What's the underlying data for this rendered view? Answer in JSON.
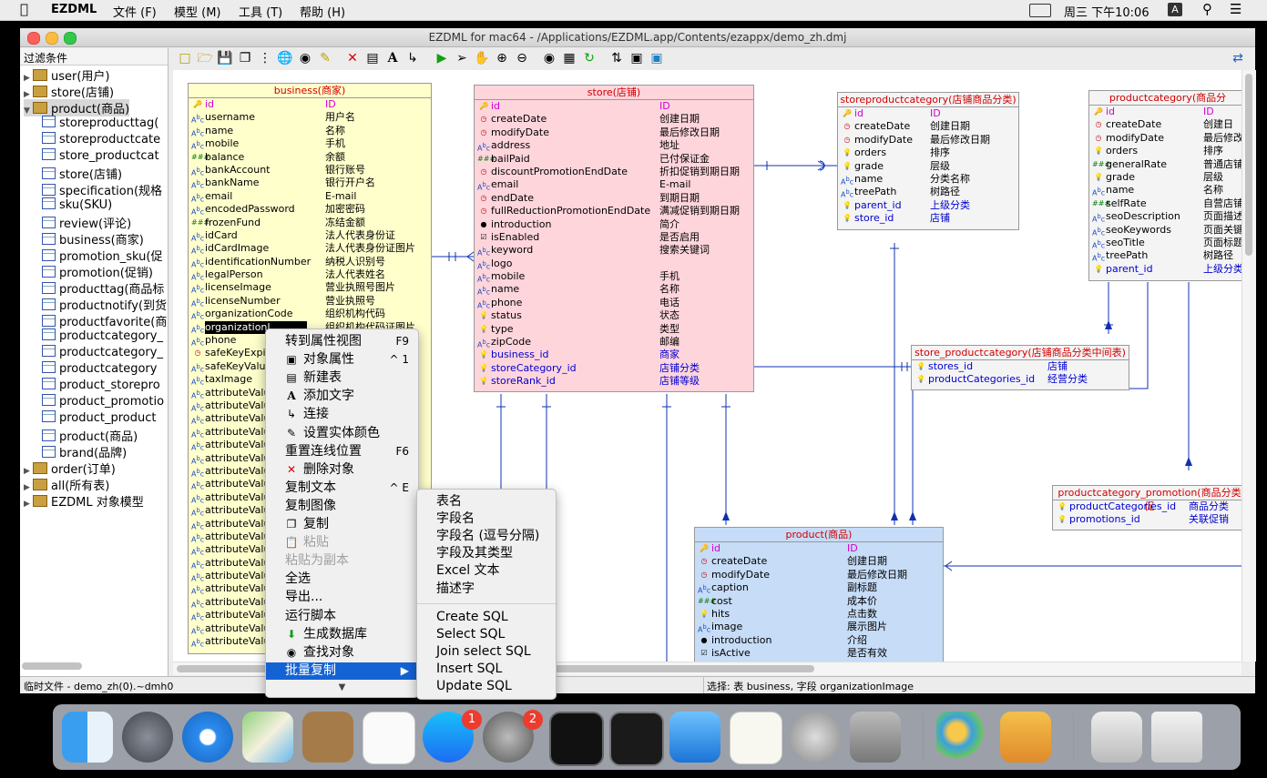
{
  "menubar": {
    "apple": "",
    "app": "EZDML",
    "items": [
      "文件 (F)",
      "模型 (M)",
      "工具 (T)",
      "帮助 (H)"
    ],
    "clock": "周三 下午10:06",
    "input_method": "A"
  },
  "window": {
    "title": "EZDML for mac64 - /Applications/EZDML.app/Contents/ezappx/demo_zh.dmj"
  },
  "left_panel": {
    "filter_label": "过滤条件",
    "tree": [
      {
        "label": "user(用户)",
        "level": 0,
        "type": "folder",
        "expanded": false
      },
      {
        "label": "store(店铺)",
        "level": 0,
        "type": "folder",
        "expanded": false
      },
      {
        "label": "product(商品)",
        "level": 0,
        "type": "folder",
        "expanded": true,
        "selected": true
      },
      {
        "label": "storeproducttag(",
        "level": 1,
        "type": "table"
      },
      {
        "label": "storeproductcate",
        "level": 1,
        "type": "table"
      },
      {
        "label": "store_productcat",
        "level": 1,
        "type": "table"
      },
      {
        "label": "store(店铺)",
        "level": 1,
        "type": "table"
      },
      {
        "label": "specification(规格",
        "level": 1,
        "type": "table"
      },
      {
        "label": "sku(SKU)",
        "level": 1,
        "type": "table"
      },
      {
        "label": "review(评论)",
        "level": 1,
        "type": "table"
      },
      {
        "label": "business(商家)",
        "level": 1,
        "type": "table"
      },
      {
        "label": "promotion_sku(促",
        "level": 1,
        "type": "table"
      },
      {
        "label": "promotion(促销)",
        "level": 1,
        "type": "table"
      },
      {
        "label": "producttag(商品标",
        "level": 1,
        "type": "table"
      },
      {
        "label": "productnotify(到货",
        "level": 1,
        "type": "table"
      },
      {
        "label": "productfavorite(商",
        "level": 1,
        "type": "table"
      },
      {
        "label": "productcategory_",
        "level": 1,
        "type": "table"
      },
      {
        "label": "productcategory_",
        "level": 1,
        "type": "table"
      },
      {
        "label": "productcategory",
        "level": 1,
        "type": "table"
      },
      {
        "label": "product_storepro",
        "level": 1,
        "type": "table"
      },
      {
        "label": "product_promotio",
        "level": 1,
        "type": "table"
      },
      {
        "label": "product_product",
        "level": 1,
        "type": "table"
      },
      {
        "label": "product(商品)",
        "level": 1,
        "type": "table"
      },
      {
        "label": "brand(品牌)",
        "level": 1,
        "type": "table"
      },
      {
        "label": "order(订单)",
        "level": 0,
        "type": "folder",
        "expanded": false
      },
      {
        "label": "all(所有表)",
        "level": 0,
        "type": "folder",
        "expanded": false
      },
      {
        "label": "EZDML 对象模型",
        "level": 0,
        "type": "folder",
        "expanded": false
      }
    ]
  },
  "entities": {
    "business": {
      "title": "business(商家)",
      "rows": [
        {
          "icon": "key",
          "name": "id",
          "cn": "ID",
          "kind": "pk"
        },
        {
          "icon": "abc",
          "name": "username",
          "cn": "用户名"
        },
        {
          "icon": "abc",
          "name": "name",
          "cn": "名称"
        },
        {
          "icon": "abc",
          "name": "mobile",
          "cn": "手机"
        },
        {
          "icon": "num",
          "name": "balance",
          "cn": "余额"
        },
        {
          "icon": "abc",
          "name": "bankAccount",
          "cn": "银行账号"
        },
        {
          "icon": "abc",
          "name": "bankName",
          "cn": "银行开户名"
        },
        {
          "icon": "abc",
          "name": "email",
          "cn": "E-mail"
        },
        {
          "icon": "abc",
          "name": "encodedPassword",
          "cn": "加密密码"
        },
        {
          "icon": "num",
          "name": "frozenFund",
          "cn": "冻结金额"
        },
        {
          "icon": "abc",
          "name": "idCard",
          "cn": "法人代表身份证"
        },
        {
          "icon": "abc",
          "name": "idCardImage",
          "cn": "法人代表身份证图片"
        },
        {
          "icon": "abc",
          "name": "identificationNumber",
          "cn": "纳税人识别号"
        },
        {
          "icon": "abc",
          "name": "legalPerson",
          "cn": "法人代表姓名"
        },
        {
          "icon": "abc",
          "name": "licenseImage",
          "cn": "营业执照号图片"
        },
        {
          "icon": "abc",
          "name": "licenseNumber",
          "cn": "营业执照号"
        },
        {
          "icon": "abc",
          "name": "organizationCode",
          "cn": "组织机构代码"
        },
        {
          "icon": "abc",
          "name": "organizationI",
          "cn": "组织机构代码证图片",
          "selected": true
        },
        {
          "icon": "abc",
          "name": "phone",
          "cn": ""
        },
        {
          "icon": "clock",
          "name": "safeKeyExpir",
          "cn": ""
        },
        {
          "icon": "abc",
          "name": "safeKeyValu",
          "cn": ""
        },
        {
          "icon": "abc",
          "name": "taxImage",
          "cn": ""
        },
        {
          "icon": "abc",
          "name": "attributeValu",
          "cn": ""
        },
        {
          "icon": "abc",
          "name": "attributeValu",
          "cn": ""
        },
        {
          "icon": "abc",
          "name": "attributeValu",
          "cn": ""
        },
        {
          "icon": "abc",
          "name": "attributeValu",
          "cn": ""
        },
        {
          "icon": "abc",
          "name": "attributeValu",
          "cn": ""
        },
        {
          "icon": "abc",
          "name": "attributeValu",
          "cn": ""
        },
        {
          "icon": "abc",
          "name": "attributeValu",
          "cn": ""
        },
        {
          "icon": "abc",
          "name": "attributeValu",
          "cn": ""
        },
        {
          "icon": "abc",
          "name": "attributeValu",
          "cn": ""
        },
        {
          "icon": "abc",
          "name": "attributeValu",
          "cn": ""
        },
        {
          "icon": "abc",
          "name": "attributeValu",
          "cn": ""
        },
        {
          "icon": "abc",
          "name": "attributeValu",
          "cn": ""
        },
        {
          "icon": "abc",
          "name": "attributeValu",
          "cn": ""
        },
        {
          "icon": "abc",
          "name": "attributeValu",
          "cn": ""
        },
        {
          "icon": "abc",
          "name": "attributeValu",
          "cn": ""
        },
        {
          "icon": "abc",
          "name": "attributeValu",
          "cn": ""
        },
        {
          "icon": "abc",
          "name": "attributeValu",
          "cn": ""
        },
        {
          "icon": "abc",
          "name": "attributeValu",
          "cn": ""
        },
        {
          "icon": "abc",
          "name": "attributeValu",
          "cn": ""
        },
        {
          "icon": "abc",
          "name": "attributeValu",
          "cn": ""
        }
      ]
    },
    "store": {
      "title": "store(店铺)",
      "rows": [
        {
          "icon": "key",
          "name": "id",
          "cn": "ID",
          "kind": "pk"
        },
        {
          "icon": "clock",
          "name": "createDate",
          "cn": "创建日期"
        },
        {
          "icon": "clock",
          "name": "modifyDate",
          "cn": "最后修改日期"
        },
        {
          "icon": "abc",
          "name": "address",
          "cn": "地址"
        },
        {
          "icon": "num",
          "name": "bailPaid",
          "cn": "已付保证金"
        },
        {
          "icon": "clock",
          "name": "discountPromotionEndDate",
          "cn": "折扣促销到期日期"
        },
        {
          "icon": "abc",
          "name": "email",
          "cn": "E-mail"
        },
        {
          "icon": "clock",
          "name": "endDate",
          "cn": "到期日期"
        },
        {
          "icon": "clock",
          "name": "fullReductionPromotionEndDate",
          "cn": "满减促销到期日期"
        },
        {
          "icon": "dot",
          "name": "introduction",
          "cn": "简介"
        },
        {
          "icon": "check",
          "name": "isEnabled",
          "cn": "是否启用"
        },
        {
          "icon": "abc",
          "name": "keyword",
          "cn": "搜索关键词"
        },
        {
          "icon": "abc",
          "name": "logo",
          "cn": ""
        },
        {
          "icon": "abc",
          "name": "mobile",
          "cn": "手机"
        },
        {
          "icon": "abc",
          "name": "name",
          "cn": "名称"
        },
        {
          "icon": "abc",
          "name": "phone",
          "cn": "电话"
        },
        {
          "icon": "bulb",
          "name": "status",
          "cn": "状态"
        },
        {
          "icon": "bulb",
          "name": "type",
          "cn": "类型"
        },
        {
          "icon": "abc",
          "name": "zipCode",
          "cn": "邮编"
        },
        {
          "icon": "bulb",
          "name": "business_id",
          "cn": "商家",
          "kind": "fk"
        },
        {
          "icon": "bulb",
          "name": "storeCategory_id",
          "cn": "店铺分类",
          "kind": "fk"
        },
        {
          "icon": "bulb",
          "name": "storeRank_id",
          "cn": "店铺等级",
          "kind": "fk"
        }
      ]
    },
    "storeproductcategory": {
      "title": "storeproductcategory(店铺商品分类)",
      "rows": [
        {
          "icon": "key",
          "name": "id",
          "cn": "ID",
          "kind": "pk"
        },
        {
          "icon": "clock",
          "name": "createDate",
          "cn": "创建日期"
        },
        {
          "icon": "clock",
          "name": "modifyDate",
          "cn": "最后修改日期"
        },
        {
          "icon": "bulb",
          "name": "orders",
          "cn": "排序"
        },
        {
          "icon": "bulb",
          "name": "grade",
          "cn": "层级"
        },
        {
          "icon": "abc",
          "name": "name",
          "cn": "分类名称"
        },
        {
          "icon": "abc",
          "name": "treePath",
          "cn": "树路径"
        },
        {
          "icon": "bulb",
          "name": "parent_id",
          "cn": "上级分类",
          "kind": "fk"
        },
        {
          "icon": "bulb",
          "name": "store_id",
          "cn": "店铺",
          "kind": "fk"
        }
      ]
    },
    "productcategory": {
      "title": "productcategory(商品分",
      "rows": [
        {
          "icon": "key",
          "name": "id",
          "cn": "ID",
          "kind": "pk"
        },
        {
          "icon": "clock",
          "name": "createDate",
          "cn": "创建日"
        },
        {
          "icon": "clock",
          "name": "modifyDate",
          "cn": "最后修改"
        },
        {
          "icon": "bulb",
          "name": "orders",
          "cn": "排序"
        },
        {
          "icon": "num",
          "name": "generalRate",
          "cn": "普通店铺"
        },
        {
          "icon": "bulb",
          "name": "grade",
          "cn": "层级"
        },
        {
          "icon": "abc",
          "name": "name",
          "cn": "名称"
        },
        {
          "icon": "num",
          "name": "selfRate",
          "cn": "自营店铺"
        },
        {
          "icon": "abc",
          "name": "seoDescription",
          "cn": "页面描述"
        },
        {
          "icon": "abc",
          "name": "seoKeywords",
          "cn": "页面关键"
        },
        {
          "icon": "abc",
          "name": "seoTitle",
          "cn": "页面标题"
        },
        {
          "icon": "abc",
          "name": "treePath",
          "cn": "树路径"
        },
        {
          "icon": "bulb",
          "name": "parent_id",
          "cn": "上级分类",
          "kind": "fk"
        }
      ]
    },
    "store_productcategory": {
      "title": "store_productcategory(店铺商品分类中间表)",
      "rows": [
        {
          "icon": "bulb",
          "name": "stores_id",
          "cn": "店铺",
          "kind": "fk"
        },
        {
          "icon": "bulb",
          "name": "productCategories_id",
          "cn": "经营分类",
          "kind": "fk"
        }
      ]
    },
    "productcategory_promotion": {
      "title": "productcategory_promotion(商品分类促",
      "rows": [
        {
          "icon": "bulb",
          "name": "productCategories_id",
          "cn": "商品分类",
          "kind": "fk"
        },
        {
          "icon": "bulb",
          "name": "promotions_id",
          "cn": "关联促销",
          "kind": "fk"
        }
      ]
    },
    "product": {
      "title": "product(商品)",
      "rows": [
        {
          "icon": "key",
          "name": "id",
          "cn": "ID",
          "kind": "pk"
        },
        {
          "icon": "clock",
          "name": "createDate",
          "cn": "创建日期"
        },
        {
          "icon": "clock",
          "name": "modifyDate",
          "cn": "最后修改日期"
        },
        {
          "icon": "abc",
          "name": "caption",
          "cn": "副标题"
        },
        {
          "icon": "num",
          "name": "cost",
          "cn": "成本价"
        },
        {
          "icon": "bulb",
          "name": "hits",
          "cn": "点击数"
        },
        {
          "icon": "abc",
          "name": "image",
          "cn": "展示图片"
        },
        {
          "icon": "dot",
          "name": "introduction",
          "cn": "介绍"
        },
        {
          "icon": "check",
          "name": "isActive",
          "cn": "是否有效"
        }
      ]
    }
  },
  "context_menu": {
    "items": [
      {
        "label": "转到属性视图",
        "shortcut": "F9",
        "icon": ""
      },
      {
        "label": "对象属性",
        "shortcut": "^ 1",
        "icon": "props"
      },
      {
        "label": "新建表",
        "shortcut": "",
        "icon": "table"
      },
      {
        "label": "添加文字",
        "shortcut": "",
        "icon": "A"
      },
      {
        "label": "连接",
        "shortcut": "",
        "icon": "link"
      },
      {
        "label": "设置实体颜色",
        "shortcut": "",
        "icon": "pen"
      },
      {
        "label": "重置连线位置",
        "shortcut": "F6",
        "icon": ""
      },
      {
        "label": "删除对象",
        "shortcut": "",
        "icon": "x"
      },
      {
        "label": "复制文本",
        "shortcut": "^ E",
        "icon": ""
      },
      {
        "label": "复制图像",
        "shortcut": "",
        "icon": ""
      },
      {
        "label": "复制",
        "shortcut": "",
        "icon": "copy"
      },
      {
        "label": "粘贴",
        "shortcut": "",
        "icon": "paste",
        "disabled": true
      },
      {
        "label": "粘贴为副本",
        "shortcut": "",
        "icon": "",
        "disabled": true
      },
      {
        "label": "全选",
        "shortcut": "",
        "icon": ""
      },
      {
        "label": "导出...",
        "shortcut": "",
        "icon": ""
      },
      {
        "label": "运行脚本",
        "shortcut": "",
        "icon": ""
      },
      {
        "label": "生成数据库",
        "shortcut": "",
        "icon": "db"
      },
      {
        "label": "查找对象",
        "shortcut": "",
        "icon": "find"
      },
      {
        "label": "批量复制",
        "shortcut": "▶",
        "icon": "",
        "selected": true
      }
    ],
    "more": "▼"
  },
  "submenu": {
    "items": [
      "表名",
      "字段名",
      "字段名 (逗号分隔)",
      "字段及其类型",
      "Excel 文本",
      "描述字",
      "",
      "Create SQL",
      "Select SQL",
      "Join select SQL",
      "Insert SQL",
      "Update SQL"
    ]
  },
  "status": {
    "left": "临时文件 - demo_zh(0).~dmh0",
    "right": "选择: 表 business, 字段 organizationImage"
  },
  "dock": {
    "apps": [
      "finder-icon",
      "launchpad-icon",
      "safari-icon",
      "maps-icon",
      "contacts-icon",
      "reminders-icon",
      "app-store-icon",
      "system-preferences-icon",
      "activity-monitor-icon",
      "terminal-icon",
      "xcode-icon",
      "textedit-icon",
      "keychain-icon",
      "disk-utility-icon",
      "ezdml-logo-icon",
      "ezdml-db-icon",
      "archive-utility-icon",
      "trash-icon"
    ],
    "app_store_badge": "1",
    "system_preferences_badge": "2"
  },
  "colors": {
    "business_bg": "#ffffcc",
    "store_bg": "#ffd5dc",
    "product_bg": "#c6dcf7",
    "default_bg": "#f4f4f4",
    "title_red": "#d00000",
    "fk_blue": "#0000d0",
    "pk_magenta": "#d000d0",
    "menu_highlight": "#1463d4"
  }
}
